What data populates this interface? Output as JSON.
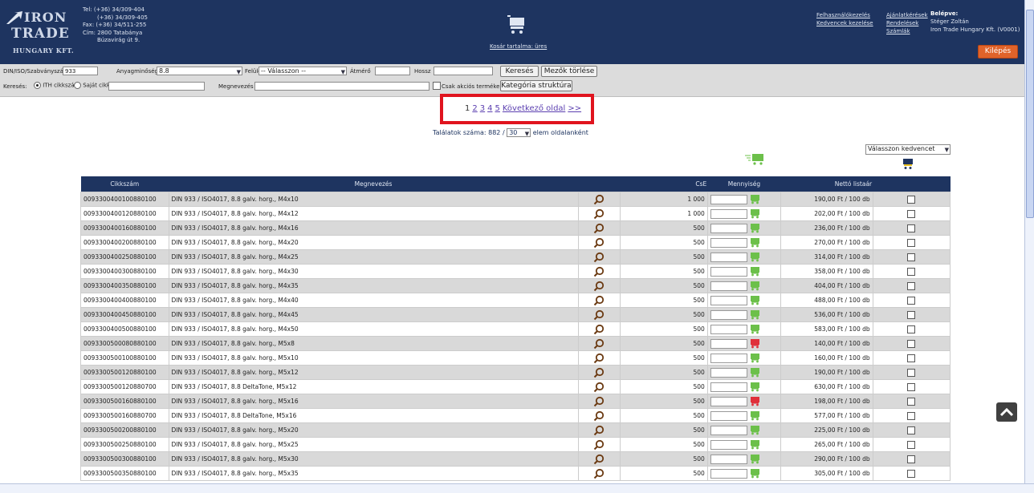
{
  "header": {
    "logo_line1": "IRON",
    "logo_line2": "TRADE",
    "logo_line3": "HUNGARY KFT.",
    "contact": [
      "Tel: (+36) 34/309-404",
      "(+36) 34/309-405",
      "Fax: (+36) 34/511-255",
      "Cím: 2800 Tatabánya",
      "Búzavirág út 9."
    ],
    "cart_label": "Kosár tartalma: üres",
    "links_col1": [
      "Felhasználókezelés",
      "Kedvencek kezelése"
    ],
    "links_col2": [
      "Ajánlatkérések",
      "Rendelések",
      "Számlák"
    ],
    "login_title": "Belépve:",
    "login_user": "Stéger Zoltán",
    "login_company": "Iron Trade Hungary Kft. (V0001)",
    "logout_label": "Kilépés"
  },
  "filters": {
    "din_label": "DIN/ISO/Szabványszám",
    "din_value": "933",
    "material_label": "Anyagminőség",
    "material_value": "8.8",
    "surface_label": "Felület",
    "surface_value": "-- Válasszon --",
    "diameter_label": "Átmérő",
    "length_label": "Hossz",
    "search_button": "Keresés",
    "clear_button": "Mezők törlése",
    "search_label": "Keresés:",
    "radio_ith": "ITH cikkszám",
    "radio_own": "Saját cikkszám",
    "name_label": "Megnevezés",
    "sale_only_label": "Csak akciós termékek",
    "category_button": "Kategória struktúra"
  },
  "pager": {
    "pages": [
      "1",
      "2",
      "3",
      "4",
      "5"
    ],
    "next": "Következő oldal",
    "last": ">>"
  },
  "results": {
    "label_prefix": "Találatok száma: 882 / ",
    "per_page": "30",
    "label_suffix": " elem oldalanként"
  },
  "favorites": {
    "placeholder": "Válasszon kedvencet"
  },
  "table": {
    "headers": [
      "Cikkszám",
      "Megnevezés",
      "",
      "CsE",
      "Mennyiség",
      "Nettó listaár",
      ""
    ],
    "rows": [
      {
        "code": "0093300400100880100",
        "name": "DIN 933 / ISO4017, 8.8 galv. horg., M4x10",
        "cse": "1 000",
        "price": "190,00 Ft / 100 db",
        "cart": "green"
      },
      {
        "code": "0093300400120880100",
        "name": "DIN 933 / ISO4017, 8.8 galv. horg., M4x12",
        "cse": "1 000",
        "price": "202,00 Ft / 100 db",
        "cart": "green"
      },
      {
        "code": "0093300400160880100",
        "name": "DIN 933 / ISO4017, 8.8 galv. horg., M4x16",
        "cse": "500",
        "price": "236,00 Ft / 100 db",
        "cart": "green"
      },
      {
        "code": "0093300400200880100",
        "name": "DIN 933 / ISO4017, 8.8 galv. horg., M4x20",
        "cse": "500",
        "price": "270,00 Ft / 100 db",
        "cart": "green"
      },
      {
        "code": "0093300400250880100",
        "name": "DIN 933 / ISO4017, 8.8 galv. horg., M4x25",
        "cse": "500",
        "price": "314,00 Ft / 100 db",
        "cart": "green"
      },
      {
        "code": "0093300400300880100",
        "name": "DIN 933 / ISO4017, 8.8 galv. horg., M4x30",
        "cse": "500",
        "price": "358,00 Ft / 100 db",
        "cart": "green"
      },
      {
        "code": "0093300400350880100",
        "name": "DIN 933 / ISO4017, 8.8 galv. horg., M4x35",
        "cse": "500",
        "price": "404,00 Ft / 100 db",
        "cart": "green"
      },
      {
        "code": "0093300400400880100",
        "name": "DIN 933 / ISO4017, 8.8 galv. horg., M4x40",
        "cse": "500",
        "price": "488,00 Ft / 100 db",
        "cart": "green"
      },
      {
        "code": "0093300400450880100",
        "name": "DIN 933 / ISO4017, 8.8 galv. horg., M4x45",
        "cse": "500",
        "price": "536,00 Ft / 100 db",
        "cart": "green"
      },
      {
        "code": "0093300400500880100",
        "name": "DIN 933 / ISO4017, 8.8 galv. horg., M4x50",
        "cse": "500",
        "price": "583,00 Ft / 100 db",
        "cart": "green"
      },
      {
        "code": "0093300500080880100",
        "name": "DIN 933 / ISO4017, 8.8 galv. horg., M5x8",
        "cse": "500",
        "price": "140,00 Ft / 100 db",
        "cart": "red"
      },
      {
        "code": "0093300500100880100",
        "name": "DIN 933 / ISO4017, 8.8 galv. horg., M5x10",
        "cse": "500",
        "price": "160,00 Ft / 100 db",
        "cart": "green"
      },
      {
        "code": "0093300500120880100",
        "name": "DIN 933 / ISO4017, 8.8 galv. horg., M5x12",
        "cse": "500",
        "price": "190,00 Ft / 100 db",
        "cart": "green"
      },
      {
        "code": "0093300500120880700",
        "name": "DIN 933 / ISO4017, 8.8 DeltaTone, M5x12",
        "cse": "500",
        "price": "630,00 Ft / 100 db",
        "cart": "green"
      },
      {
        "code": "0093300500160880100",
        "name": "DIN 933 / ISO4017, 8.8 galv. horg., M5x16",
        "cse": "500",
        "price": "198,00 Ft / 100 db",
        "cart": "red"
      },
      {
        "code": "0093300500160880700",
        "name": "DIN 933 / ISO4017, 8.8 DeltaTone, M5x16",
        "cse": "500",
        "price": "577,00 Ft / 100 db",
        "cart": "green"
      },
      {
        "code": "0093300500200880100",
        "name": "DIN 933 / ISO4017, 8.8 galv. horg., M5x20",
        "cse": "500",
        "price": "225,00 Ft / 100 db",
        "cart": "green"
      },
      {
        "code": "0093300500250880100",
        "name": "DIN 933 / ISO4017, 8.8 galv. horg., M5x25",
        "cse": "500",
        "price": "265,00 Ft / 100 db",
        "cart": "green"
      },
      {
        "code": "0093300500300880100",
        "name": "DIN 933 / ISO4017, 8.8 galv. horg., M5x30",
        "cse": "500",
        "price": "290,00 Ft / 100 db",
        "cart": "green"
      },
      {
        "code": "0093300500350880100",
        "name": "DIN 933 / ISO4017, 8.8 galv. horg., M5x35",
        "cse": "500",
        "price": "305,00 Ft / 100 db",
        "cart": "green"
      }
    ]
  },
  "colors": {
    "header_bg": "#1e3460",
    "cart_green": "#6cc04a",
    "cart_red": "#e0303a",
    "highlight": "#e0141e",
    "logout_bg": "#e0632a"
  }
}
